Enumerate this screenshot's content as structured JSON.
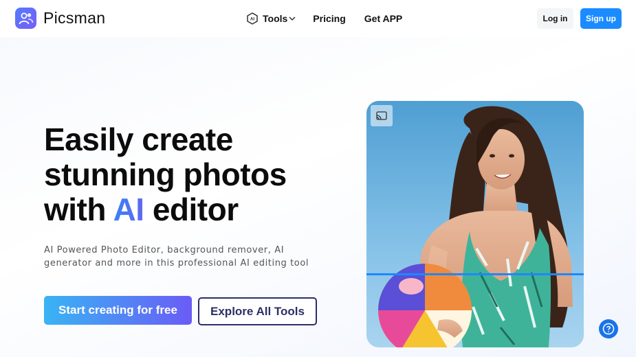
{
  "brand": {
    "name": "Picsman",
    "logo_icon": "users-icon",
    "accent": "#1a8cff"
  },
  "nav": {
    "tools_label": "Tools",
    "pricing_label": "Pricing",
    "getapp_label": "Get APP"
  },
  "auth": {
    "login_label": "Log in",
    "signup_label": "Sign up"
  },
  "hero": {
    "title_line1": "Easily create",
    "title_line2": "stunning photos",
    "title_line3_pre": "with ",
    "title_line3_ai": "AI",
    "title_line3_post": " editor",
    "subtitle": "AI Powered Photo Editor, background remover, AI generator and more in this professional AI editing tool",
    "cta_primary": "Start creating for free",
    "cta_secondary": "Explore All Tools"
  },
  "photo": {
    "icon": "cast-icon",
    "divider_color": "#1e88ff"
  },
  "help": {
    "icon": "help-icon"
  }
}
